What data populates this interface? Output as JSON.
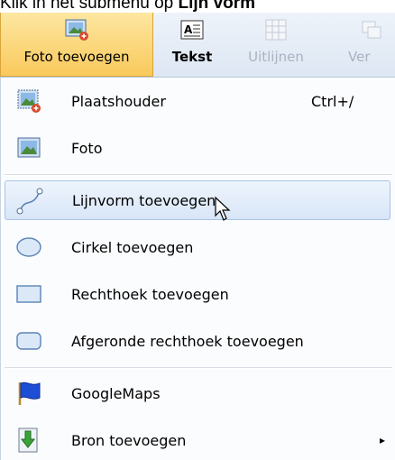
{
  "caption": {
    "text": "Klik in het submenu op ",
    "bold": "Lijn vorm"
  },
  "ribbon": {
    "buttons": [
      {
        "label": "Foto toevoegen",
        "icon": "add-photo-icon",
        "state": "pressed"
      },
      {
        "label": "Tekst",
        "icon": "text-icon",
        "state": "normal"
      },
      {
        "label": "Uitlijnen",
        "icon": "grid-icon",
        "state": "disabled"
      },
      {
        "label": "Ver",
        "icon": "arrange-icon",
        "state": "disabled"
      }
    ]
  },
  "menu": {
    "items": [
      {
        "label": "Plaatshouder",
        "shortcut": "Ctrl+/",
        "icon": "placeholder-icon"
      },
      {
        "label": "Foto",
        "icon": "photo-icon"
      },
      {
        "label": "Lijnvorm toevoegen",
        "icon": "line-shape-icon",
        "state": "hover"
      },
      {
        "label": "Cirkel toevoegen",
        "icon": "circle-shape-icon"
      },
      {
        "label": "Rechthoek toevoegen",
        "icon": "rectangle-shape-icon"
      },
      {
        "label": "Afgeronde rechthoek toevoegen",
        "icon": "rounded-rectangle-icon"
      },
      {
        "label": "GoogleMaps",
        "icon": "flag-icon"
      },
      {
        "label": "Bron toevoegen",
        "icon": "download-arrow-icon",
        "submenu_arrow": "▸"
      }
    ]
  },
  "colors": {
    "hover_border": "#a9c3e6",
    "pressed_bg": "#f9c95b",
    "shape_fill": "#dbe8f7",
    "shape_stroke": "#5b84b8"
  }
}
